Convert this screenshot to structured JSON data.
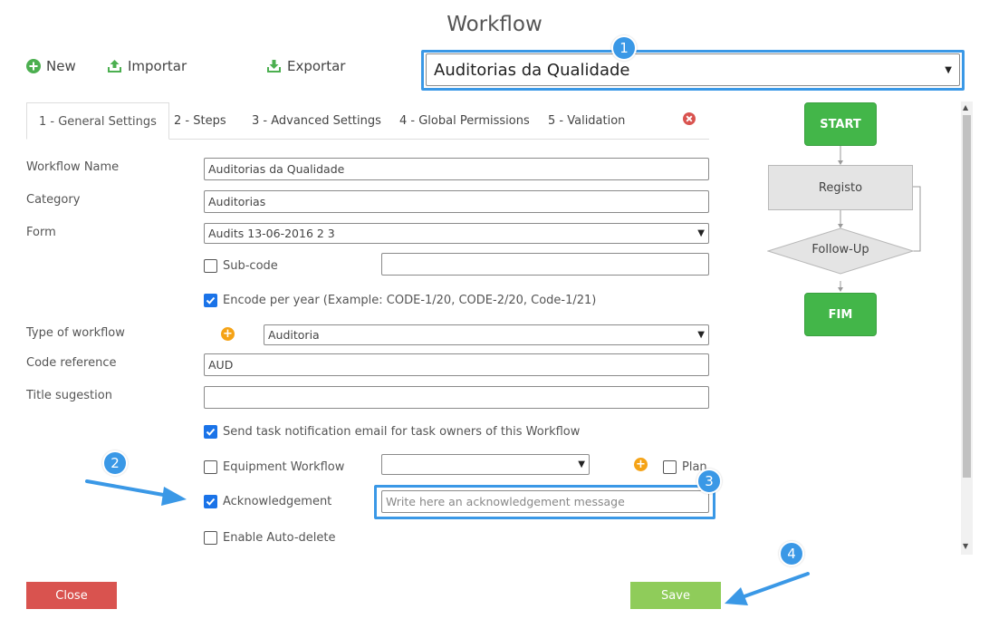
{
  "header": {
    "title": "Workflow"
  },
  "toolbar": {
    "new_label": "New",
    "import_label": "Importar",
    "export_label": "Exportar"
  },
  "workflow_selector": {
    "value": "Auditorias da Qualidade"
  },
  "tabs": [
    {
      "label": "1 - General Settings"
    },
    {
      "label": "2 - Steps"
    },
    {
      "label": "3 - Advanced Settings"
    },
    {
      "label": "4 - Global Permissions"
    },
    {
      "label": "5 - Validation"
    }
  ],
  "form": {
    "workflow_name": {
      "label": "Workflow Name",
      "value": "Auditorias da Qualidade"
    },
    "category": {
      "label": "Category",
      "value": "Auditorias"
    },
    "form": {
      "label": "Form",
      "value": "Audits 13-06-2016 2 3"
    },
    "sub_code": {
      "label": "Sub-code",
      "value": ""
    },
    "encode_per_year": {
      "label": "Encode per year (Example: CODE-1/20, CODE-2/20, Code-1/21)"
    },
    "type_of_workflow": {
      "label": "Type of workflow",
      "value": "Auditoria"
    },
    "code_reference": {
      "label": "Code reference",
      "value": "AUD"
    },
    "title_suggestion": {
      "label": "Title sugestion",
      "value": ""
    },
    "send_notification": {
      "label": "Send task notification email for task owners of this Workflow"
    },
    "equipment_workflow": {
      "label": "Equipment Workflow",
      "value": ""
    },
    "plan": {
      "label": "Plan"
    },
    "acknowledgement": {
      "label": "Acknowledgement",
      "placeholder": "Write here an acknowledgement message"
    },
    "auto_delete": {
      "label": "Enable Auto-delete"
    }
  },
  "flow": {
    "start": "START",
    "registo": "Registo",
    "follow_up": "Follow-Up",
    "end": "FIM"
  },
  "badges": [
    "1",
    "2",
    "3",
    "4"
  ],
  "buttons": {
    "close": "Close",
    "save": "Save"
  },
  "colors": {
    "accent": "#3a98e6",
    "close_button": "#d9534f",
    "save_button": "#8fcc5a",
    "node_green": "#43b649",
    "checkbox": "#1a73e8",
    "add_icon": "#f5a316",
    "remove_icon": "#d9534f"
  }
}
